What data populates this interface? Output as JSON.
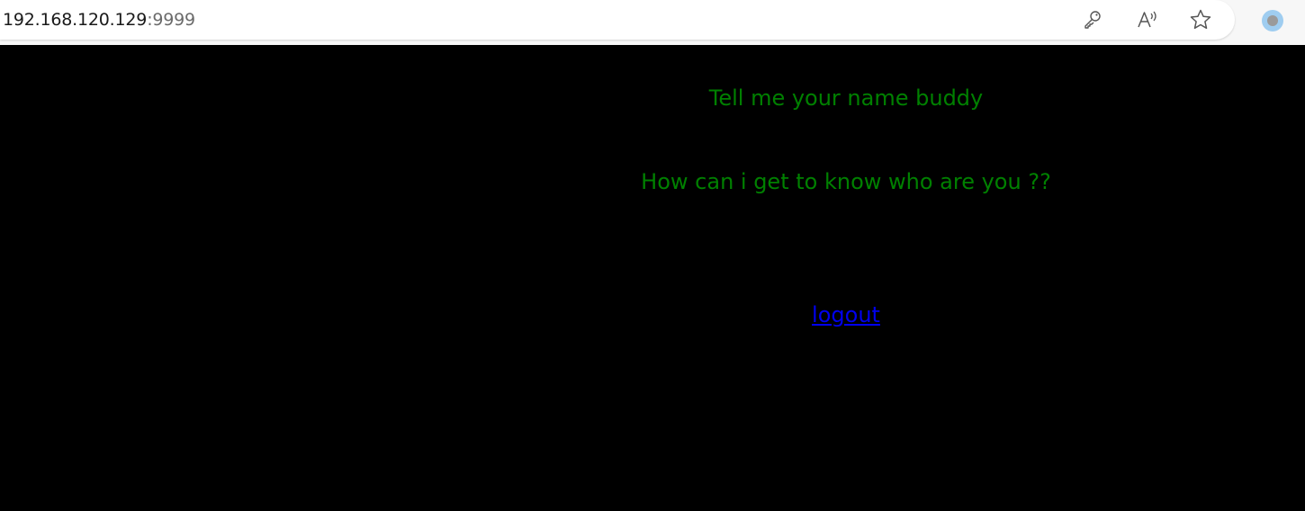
{
  "browser": {
    "url_host": "192.168.120.129",
    "url_port": ":9999",
    "icons": [
      "key-icon",
      "read-aloud-icon",
      "star-icon",
      "profile-icon"
    ]
  },
  "page": {
    "heading_1": "Tell me your name buddy",
    "heading_2": "How can i get to know who are you ??",
    "logout_label": "logout",
    "text_color": "#008000",
    "link_color": "#0000ee",
    "background": "#000000"
  }
}
